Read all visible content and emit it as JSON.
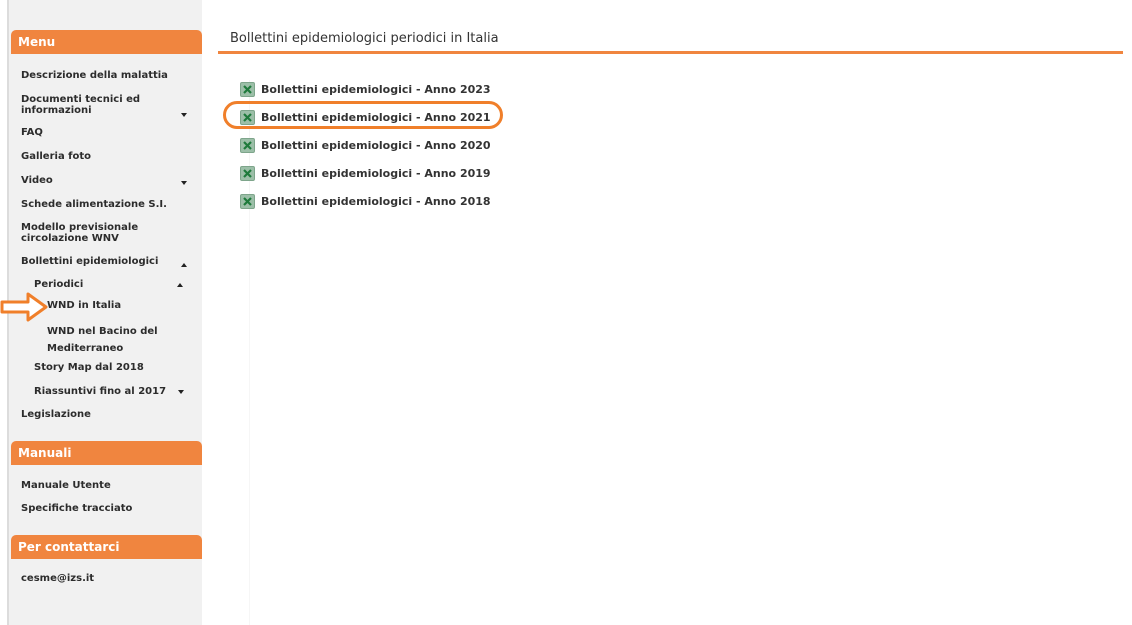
{
  "sidebar": {
    "menu_header": "Menu",
    "items": {
      "descrizione": "Descrizione della malattia",
      "documenti_line1": "Documenti tecnici ed",
      "documenti_line2": "informazioni",
      "faq": "FAQ",
      "galleria": "Galleria foto",
      "video": "Video",
      "schede": "Schede alimentazione S.I.",
      "modello_line1": "Modello previsionale",
      "modello_line2": "circolazione WNV",
      "bollettini": "Bollettini epidemiologici",
      "periodici": "Periodici",
      "wnd_italia": "WND in Italia",
      "wnd_mediterraneo_line1": "WND nel Bacino del",
      "wnd_mediterraneo_line2": "Mediterraneo",
      "story_map": "Story Map dal 2018",
      "riassuntivi": "Riassuntivi fino al 2017",
      "legislazione": "Legislazione"
    },
    "manuali_header": "Manuali",
    "manuali": {
      "manuale_utente": "Manuale Utente",
      "specifiche": "Specifiche tracciato"
    },
    "contatti_header": "Per contattarci",
    "contatti": {
      "email": "cesme@izs.it"
    }
  },
  "main": {
    "title": "Bollettini epidemiologici periodici in Italia",
    "bulletins": [
      "Bollettini epidemiologici - Anno 2023",
      "Bollettini epidemiologici - Anno 2021",
      "Bollettini epidemiologici - Anno 2020",
      "Bollettini epidemiologici - Anno 2019",
      "Bollettini epidemiologici - Anno 2018"
    ]
  },
  "colors": {
    "accent": "#f0853f",
    "annotation": "#f07f2a",
    "sidebar_bg": "#f1f1f1"
  }
}
